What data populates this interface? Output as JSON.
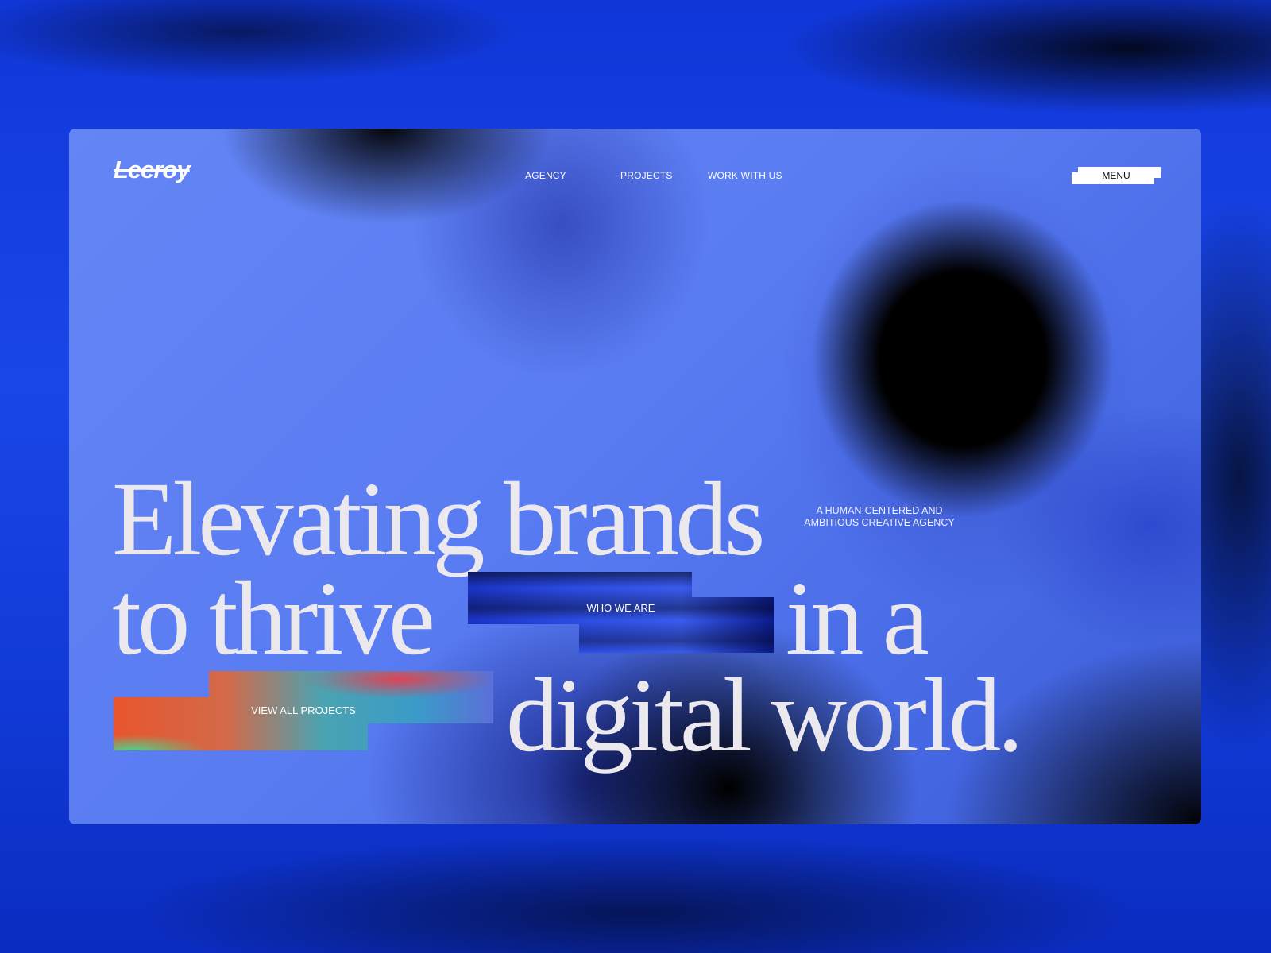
{
  "site": {
    "logo": "Leeroy"
  },
  "nav": {
    "links": [
      {
        "label": "AGENCY"
      },
      {
        "label": "PROJECTS"
      },
      {
        "label": "WORK WITH US"
      }
    ],
    "menu_label": "MENU"
  },
  "hero": {
    "headline_line1": "Elevating brands",
    "headline_line2": "to thrive",
    "headline_line2_end": "in a",
    "headline_line3": "digital world.",
    "tagline": "A HUMAN-CENTERED AND AMBITIOUS CREATIVE AGENCY",
    "who_button_label": "WHO WE ARE",
    "projects_button_label": "VIEW ALL PROJECTS"
  },
  "colors": {
    "background": "#1a47e8",
    "panel": "#5b7df2",
    "text": "#ece9ee",
    "menu_button": "#ffffff"
  }
}
